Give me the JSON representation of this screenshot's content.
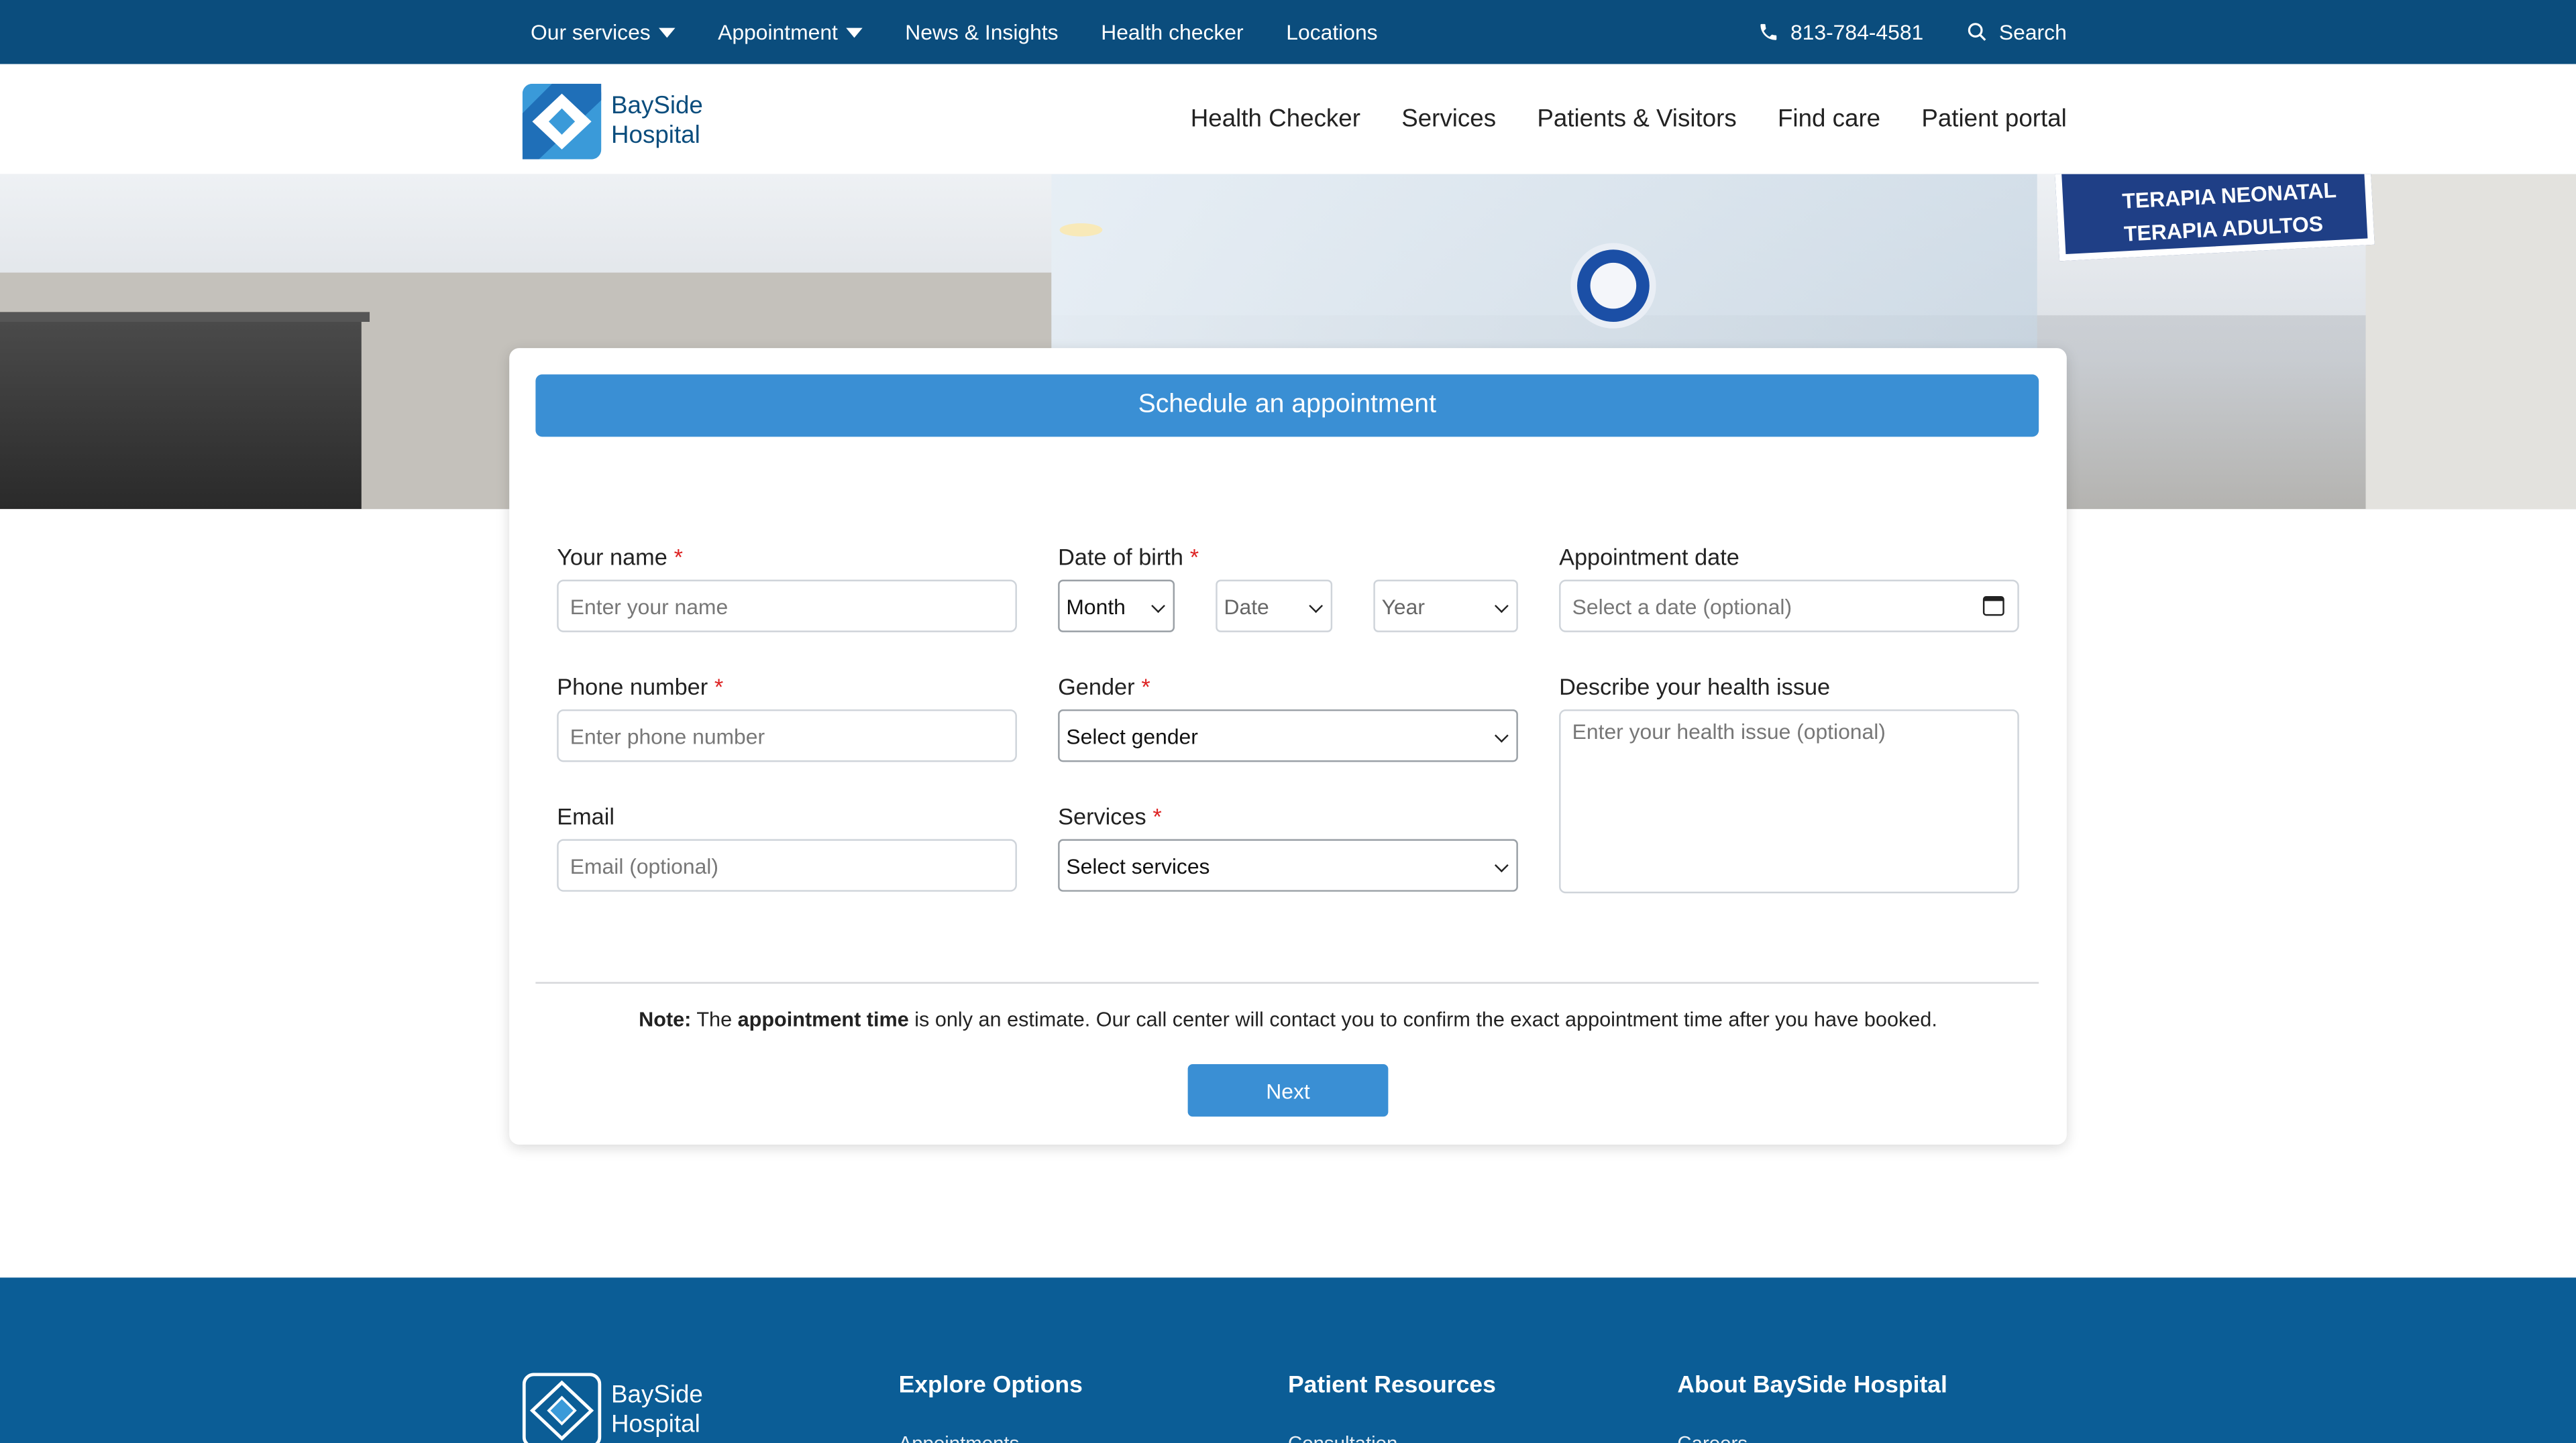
{
  "topbar": {
    "items": [
      {
        "label": "Our services",
        "dropdown": true
      },
      {
        "label": "Appointment",
        "dropdown": true
      },
      {
        "label": "News & Insights",
        "dropdown": false
      },
      {
        "label": "Health checker",
        "dropdown": false
      },
      {
        "label": "Locations",
        "dropdown": false
      }
    ],
    "phone": "813-784-4581",
    "search": "Search",
    "bg_color": "#0b4d7d"
  },
  "brand": {
    "line1": "BaySide",
    "line2": "Hospital"
  },
  "mainnav": [
    "Health Checker",
    "Services",
    "Patients & Visitors",
    "Find care",
    "Patient portal"
  ],
  "hero": {
    "sign_line1": "TERAPIA NEONATAL",
    "sign_line2": "TERAPIA ADULTOS"
  },
  "form": {
    "title": "Schedule an appointment",
    "name": {
      "label": "Your name",
      "placeholder": "Enter your name",
      "required": true
    },
    "dob": {
      "label": "Date of birth",
      "required": true,
      "month": "Month",
      "date": "Date",
      "year": "Year"
    },
    "appointment_date": {
      "label": "Appointment date",
      "placeholder": "Select a date (optional)"
    },
    "phone": {
      "label": "Phone number",
      "placeholder": "Enter phone number",
      "required": true
    },
    "gender": {
      "label": "Gender",
      "value": "Select gender",
      "required": true
    },
    "health_issue": {
      "label": "Describe your health issue",
      "placeholder": "Enter your health issue (optional)"
    },
    "email": {
      "label": "Email",
      "placeholder": "Email (optional)"
    },
    "services": {
      "label": "Services",
      "value": "Select services",
      "required": true
    },
    "required_mark": "*",
    "note": {
      "prefix": "Note:",
      "part1": " The ",
      "bold": "appointment time",
      "part2": " is only an estimate. Our call center will contact you to confirm the exact appointment time after you have booked."
    },
    "next_label": "Next",
    "accent_color": "#3a8fd4"
  },
  "footer": {
    "columns": [
      {
        "title": "Explore Options",
        "first_item": "Appointments"
      },
      {
        "title": "Patient Resources",
        "first_item": "Consultation"
      },
      {
        "title": "About BaySide Hospital",
        "first_item": "Careers"
      }
    ],
    "bg_color": "#0b5d96"
  }
}
